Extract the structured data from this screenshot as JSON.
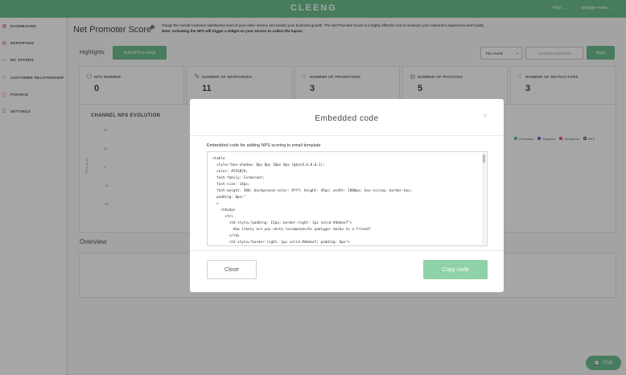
{
  "topbar": {
    "logo": "CLEENG",
    "help": "Help ⌄",
    "user": "qadigger maku ⌄"
  },
  "sidebar": {
    "items": [
      {
        "icon": "dashboard-icon",
        "glyph": "▦",
        "label": "DASHBOARD"
      },
      {
        "icon": "reporting-icon",
        "glyph": "▤",
        "label": "REPORTING"
      },
      {
        "icon": "offers-icon",
        "glyph": "▭",
        "label": "MY OFFERS"
      },
      {
        "icon": "customer-icon",
        "glyph": "⚇",
        "label": "CUSTOMER RELATIONSHIP"
      },
      {
        "icon": "finance-icon",
        "glyph": "◫",
        "label": "FINANCE"
      },
      {
        "icon": "settings-icon",
        "glyph": "☰",
        "label": "SETTINGS"
      }
    ]
  },
  "page": {
    "title": "Net Promoter Score",
    "desc": "Gauge the overall customer satisfaction level of your video service and predict your business growth. The Net Promoter Score is a highly effective tool to measure your customers experience and loyalty.",
    "note": "Note: Activating the NPS will trigger a widget on your service to collect the inputs."
  },
  "highlights": {
    "label": "Highlights",
    "add_button": "Add NPS to email",
    "period": "This month",
    "date_range": "1/1/2020 to 8/1/2020",
    "apply": "Apply"
  },
  "kpis": [
    {
      "icon": "users-icon",
      "glyph": "⚇",
      "label": "NPS NUMBER",
      "value": "0"
    },
    {
      "icon": "edit-icon",
      "glyph": "✎",
      "label": "NUMBER OF RESPONSES",
      "value": "11"
    },
    {
      "icon": "promoter-icon",
      "glyph": "☝",
      "label": "NUMBER OF PROMOTERS",
      "value": "3"
    },
    {
      "icon": "passive-icon",
      "glyph": "⊖",
      "label": "NUMBER OF PASSIVES",
      "value": "5"
    },
    {
      "icon": "detractor-icon",
      "glyph": "☟",
      "label": "NUMBER OF DETRACTORS",
      "value": "3"
    }
  ],
  "chart": {
    "title": "CHANNEL NPS EVOLUTION",
    "ylabel": "NPS score",
    "yticks": [
      "60",
      "30",
      "0",
      "-30",
      "-60"
    ],
    "legend": [
      {
        "name": "Promoters",
        "color": "#6dbf8f"
      },
      {
        "name": "Passives",
        "color": "#5b6ee1"
      },
      {
        "name": "Detractors",
        "color": "#e5607a"
      },
      {
        "name": "NPS",
        "color": "#333333"
      }
    ]
  },
  "overview": {
    "label": "Overview"
  },
  "chat": {
    "label": "Chat"
  },
  "modal": {
    "title": "Embedded code",
    "close_x": "×",
    "description": "Embedded code for adding NPS scoring to email template",
    "code_lines": [
      "<table",
      "  style=\"box-shadow: 0px 0px 10px 0px rgba(0,0,0,0.1);",
      "  color: #5F6B7A;",
      "  font-family: Cormorant;",
      "  font-size: 14px;",
      "  font-weight: 300; background-color: #fff; height: 45px; width: 1000px; box-sizing: border-box;",
      "  padding: 0px;\"",
      "  >",
      "    <tbody>",
      "      <tr>",
      "        <td style=\"padding: 15px; border-right: 1px solid #dbdee7\">",
      "          How likely are you <b>to recommend</b> qadigger maiku to a friend?",
      "        </td>",
      "        <td style=\"border-right: 1px solid #dbdee7; padding: 0px\">"
    ],
    "close_button": "Close",
    "copy_button": "Copy code"
  }
}
